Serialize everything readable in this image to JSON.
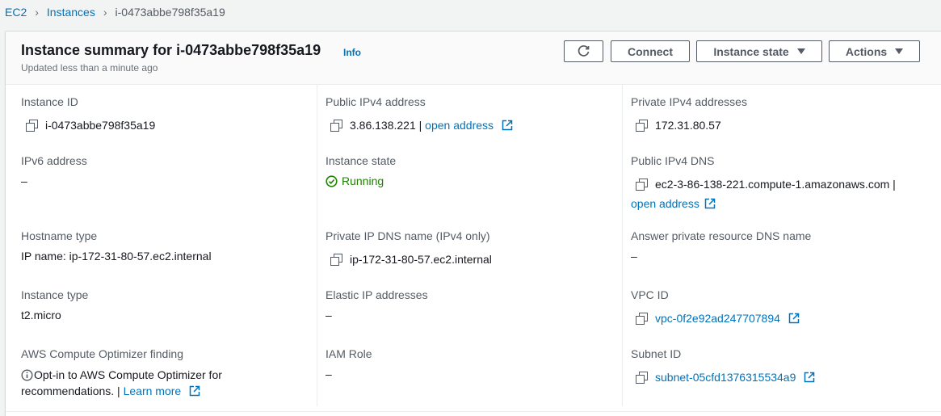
{
  "breadcrumb": {
    "root": "EC2",
    "section": "Instances",
    "current": "i-0473abbe798f35a19"
  },
  "header": {
    "title": "Instance summary for i-0473abbe798f35a19",
    "info": "Info",
    "subtitle": "Updated less than a minute ago",
    "connect": "Connect",
    "instance_state": "Instance state",
    "actions": "Actions"
  },
  "fields": {
    "instance_id_label": "Instance ID",
    "instance_id": "i-0473abbe798f35a19",
    "public_ipv4_label": "Public IPv4 address",
    "public_ipv4": "3.86.138.221",
    "public_ipv4_sep": " | ",
    "open_address": "open address",
    "private_ipv4_label": "Private IPv4 addresses",
    "private_ipv4": "172.31.80.57",
    "ipv6_label": "IPv6 address",
    "ipv6": "–",
    "instance_state_label": "Instance state",
    "instance_state": "Running",
    "public_dns_label": "Public IPv4 DNS",
    "public_dns": "ec2-3-86-138-221.compute-1.amazonaws.com |",
    "public_dns_link": "open address",
    "hostname_type_label": "Hostname type",
    "hostname_type": "IP name: ip-172-31-80-57.ec2.internal",
    "private_dns_label": "Private IP DNS name (IPv4 only)",
    "private_dns": "ip-172-31-80-57.ec2.internal",
    "answer_dns_label": "Answer private resource DNS name",
    "answer_dns": "–",
    "instance_type_label": "Instance type",
    "instance_type": "t2.micro",
    "elastic_ip_label": "Elastic IP addresses",
    "elastic_ip": "–",
    "vpc_id_label": "VPC ID",
    "vpc_id": "vpc-0f2e92ad247707894",
    "optimizer_label": "AWS Compute Optimizer finding",
    "optimizer_line1": "Opt-in to AWS Compute Optimizer for",
    "optimizer_line2": "recommendations. | ",
    "learn_more": "Learn more",
    "iam_role_label": "IAM Role",
    "iam_role": "–",
    "subnet_id_label": "Subnet ID",
    "subnet_id": "subnet-05cfd1376315534a9"
  },
  "colors": {
    "link": "#0073bb",
    "running": "#1d8102",
    "border": "#d5dbdb"
  },
  "icons": [
    "refresh-icon",
    "caret-down-icon",
    "copy-icon",
    "external-link-icon",
    "check-circle-icon",
    "info-circle-icon"
  ]
}
